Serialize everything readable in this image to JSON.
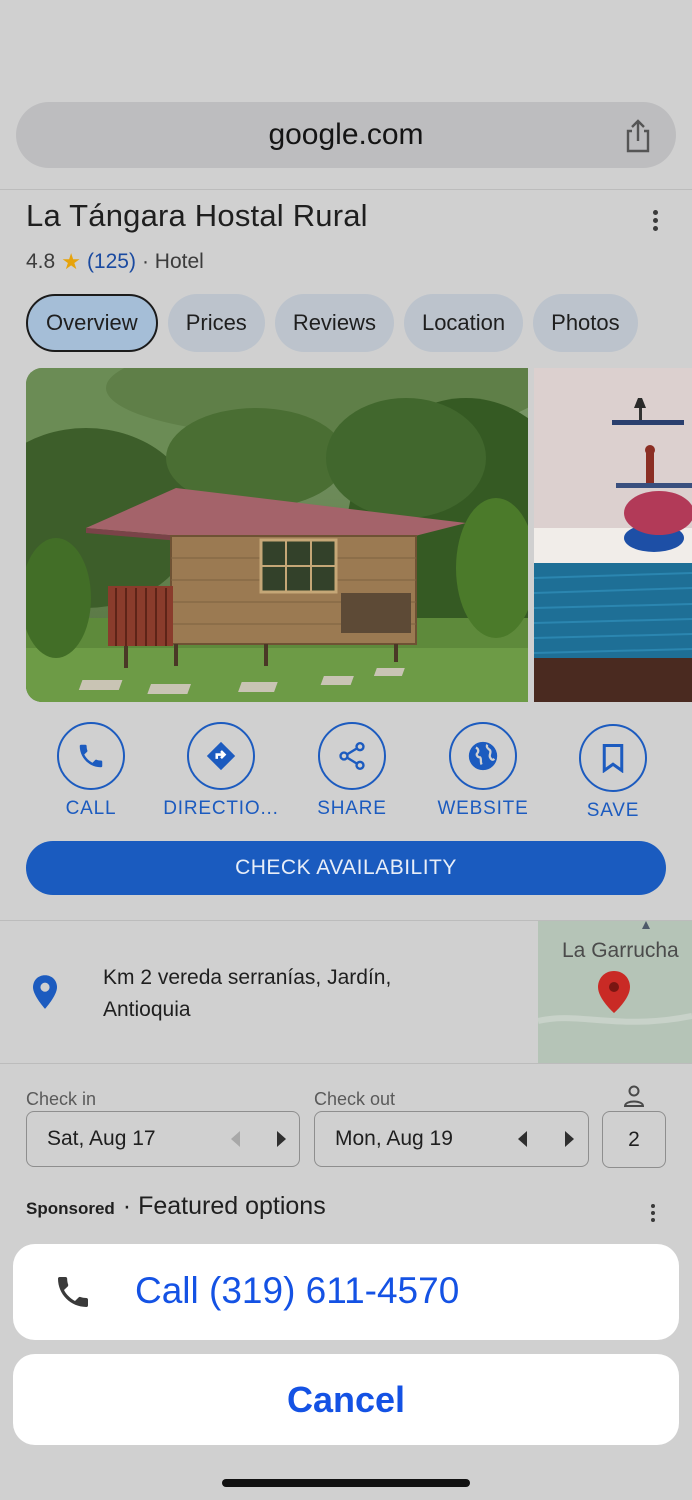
{
  "browser": {
    "url": "google.com",
    "share_icon": "share-icon"
  },
  "place": {
    "title": "La Tángara Hostal Rural",
    "rating": "4.8",
    "review_count": "(125)",
    "category": "· Hotel"
  },
  "tabs": [
    {
      "label": "Overview",
      "active": true
    },
    {
      "label": "Prices",
      "active": false
    },
    {
      "label": "Reviews",
      "active": false
    },
    {
      "label": "Location",
      "active": false
    },
    {
      "label": "Photos",
      "active": false
    }
  ],
  "actions": [
    {
      "label": "CALL",
      "icon": "phone-icon"
    },
    {
      "label": "DIRECTIO...",
      "icon": "directions-icon"
    },
    {
      "label": "SHARE",
      "icon": "share-icon"
    },
    {
      "label": "WEBSITE",
      "icon": "globe-icon"
    },
    {
      "label": "SAVE",
      "icon": "bookmark-icon"
    }
  ],
  "check_availability": "CHECK AVAILABILITY",
  "address": {
    "line1": "Km 2 vereda serranías, Jardín,",
    "line2": "Antioquia",
    "map_label": "La Garrucha"
  },
  "booking": {
    "check_in_label": "Check in",
    "check_in_value": "Sat, Aug 17",
    "check_out_label": "Check out",
    "check_out_value": "Mon, Aug 19",
    "guests": "2"
  },
  "sponsored": {
    "tag": "Sponsored",
    "title": "· Featured options"
  },
  "sheet": {
    "call_label": "Call (319) 611-4570",
    "cancel_label": "Cancel"
  },
  "colors": {
    "accent": "#1a5bbf",
    "sheet_link": "#1452e4",
    "star": "#e6a30c"
  }
}
